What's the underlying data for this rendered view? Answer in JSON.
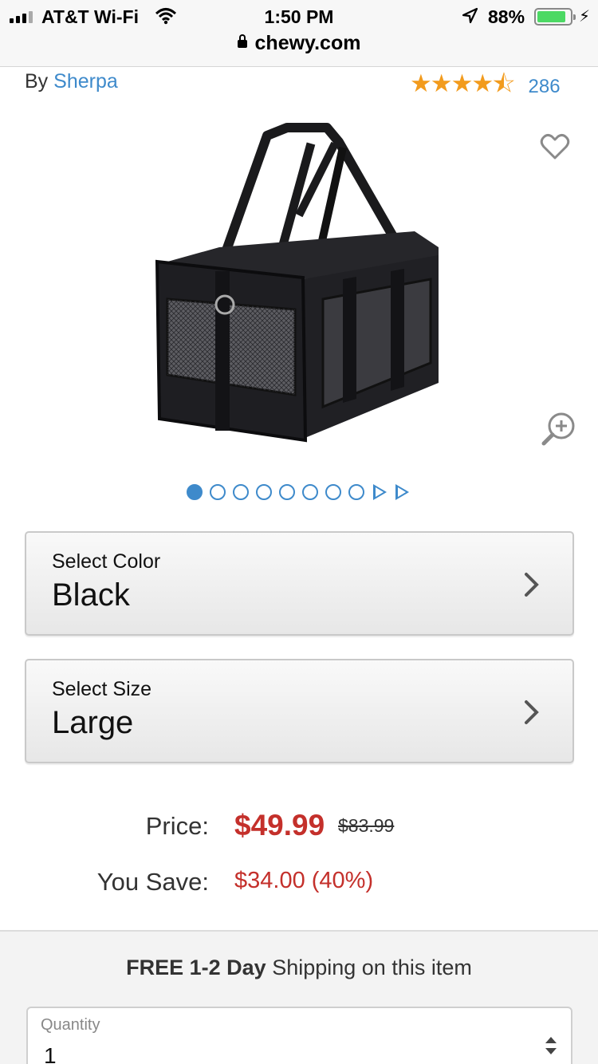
{
  "status_bar": {
    "carrier": "AT&T Wi-Fi",
    "time": "1:50 PM",
    "battery_percent": "88%",
    "battery_level": 0.88
  },
  "browser": {
    "url": "chewy.com"
  },
  "product": {
    "brand_prefix": "By",
    "brand": "Sherpa",
    "rating": 4.5,
    "review_count": "286",
    "image_icon": "pet-carrier-bag"
  },
  "carousel": {
    "total_dots": 8,
    "active_index": 0
  },
  "color_selector": {
    "label": "Select Color",
    "value": "Black"
  },
  "size_selector": {
    "label": "Select Size",
    "value": "Large"
  },
  "pricing": {
    "price_label": "Price:",
    "price": "$49.99",
    "list_price": "$83.99",
    "save_label": "You Save:",
    "savings": "$34.00 (40%)"
  },
  "shipping": {
    "bold": "FREE 1-2 Day",
    "rest": " Shipping on this item"
  },
  "quantity": {
    "label": "Quantity",
    "value": "1"
  },
  "colors": {
    "link_blue": "#3e8acb",
    "price_red": "#c4302b",
    "star_orange": "#f29b1d"
  }
}
